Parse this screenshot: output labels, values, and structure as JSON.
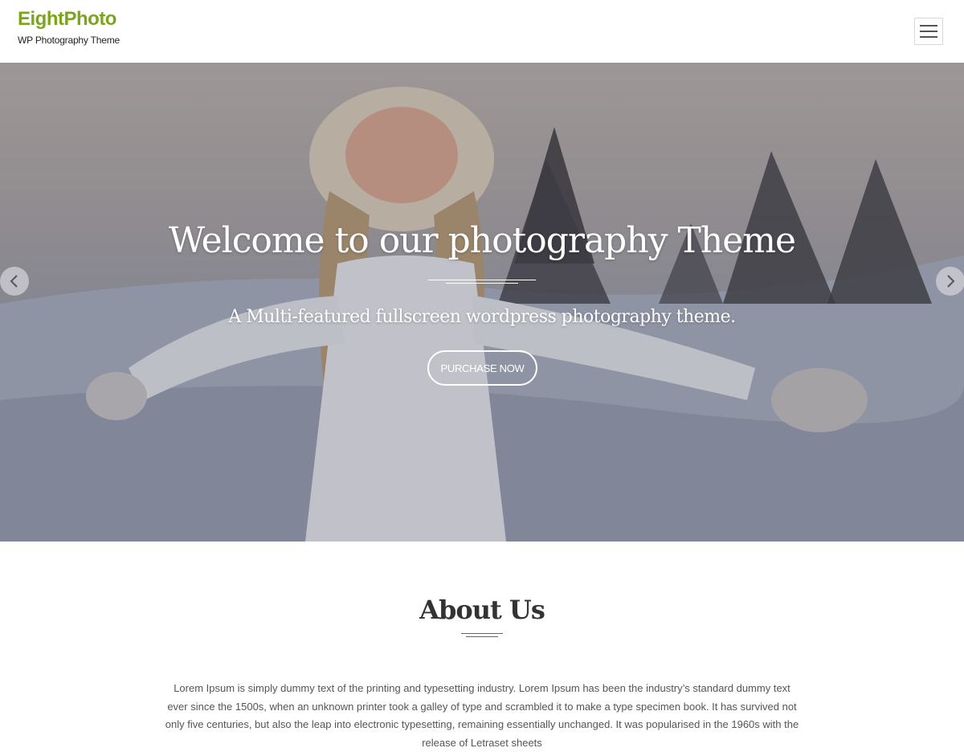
{
  "header": {
    "site_title": "EightPhoto",
    "tagline": "WP Photography Theme",
    "menu_icon": "hamburger-menu-icon"
  },
  "hero": {
    "title": "Welcome to our photography Theme",
    "subtitle": "A Multi-featured fullscreen wordpress photography theme.",
    "cta_label": "PURCHASE NOW",
    "prev_icon": "chevron-left-icon",
    "next_icon": "chevron-right-icon"
  },
  "about": {
    "title": "About Us",
    "body": "Lorem Ipsum is simply dummy text of the printing and typesetting industry. Lorem Ipsum has been the industry’s standard dummy text ever since the 1500s, when an unknown printer took a galley of type and scrambled it to make a type specimen book. It has survived not only five centuries, but also the leap into electronic typesetting, remaining essentially unchanged. It was popularised in the 1960s with the release of Letraset sheets"
  },
  "colors": {
    "brand": "#7aa51c",
    "text": "#555555",
    "white": "#ffffff"
  }
}
